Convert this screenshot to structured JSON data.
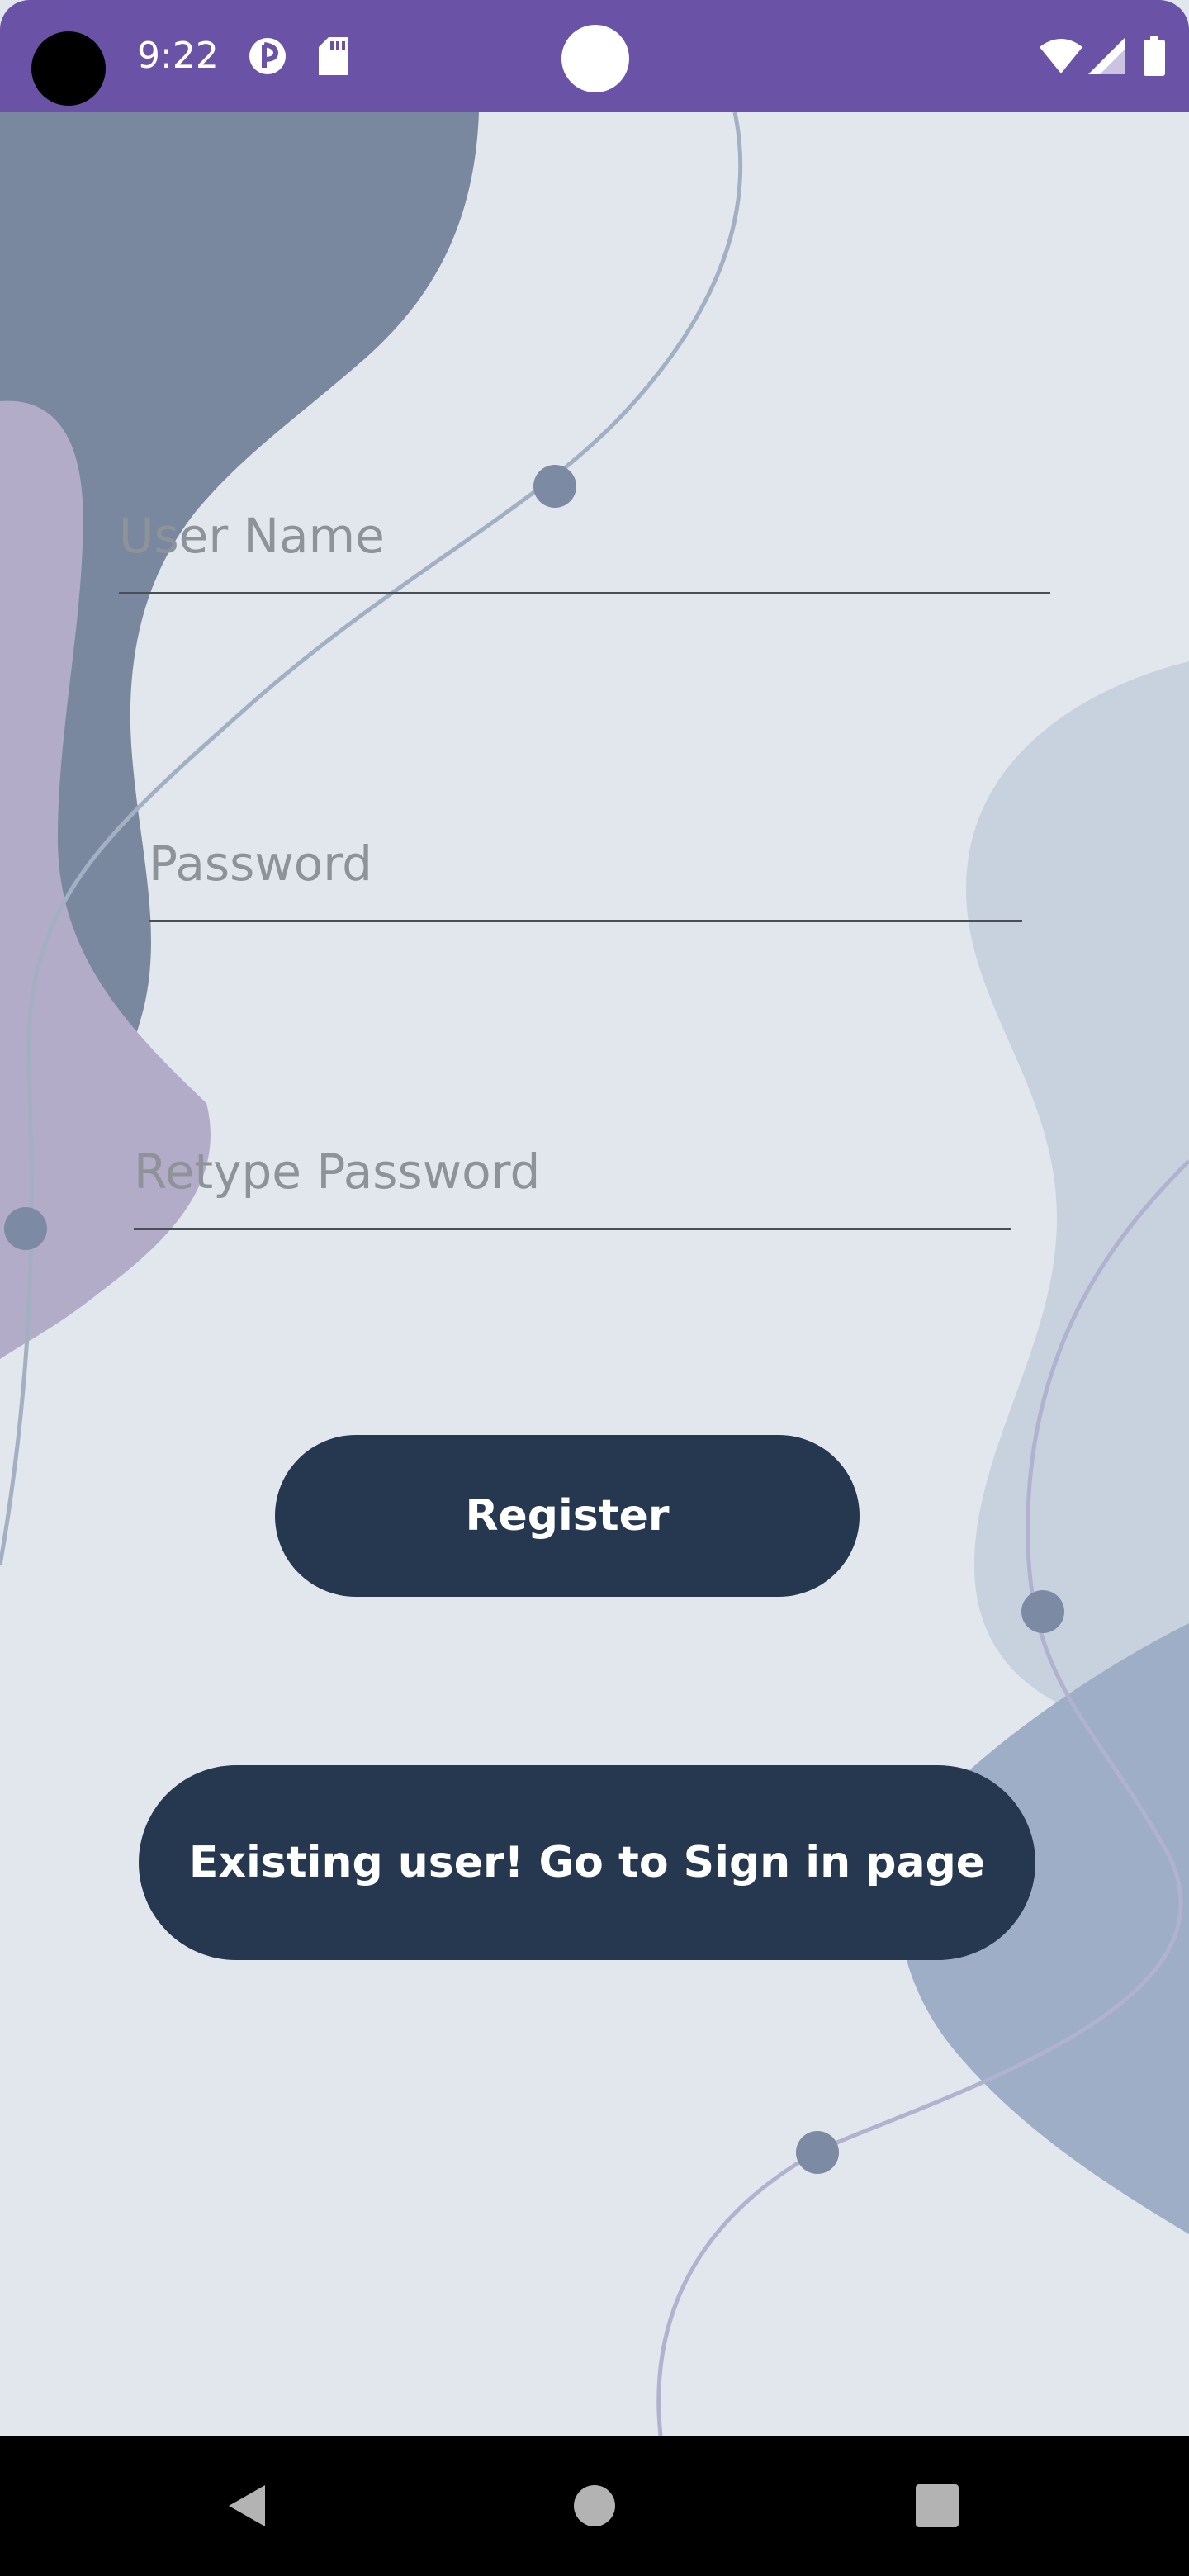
{
  "status_bar": {
    "time": "9:22",
    "icons": [
      "camera-cutout",
      "data-saver-icon",
      "sd-card-icon",
      "notification-dot",
      "wifi-icon",
      "signal-icon",
      "battery-icon"
    ]
  },
  "form": {
    "username": {
      "value": "",
      "placeholder": "User Name"
    },
    "password": {
      "value": "",
      "placeholder": "Password"
    },
    "retype_password": {
      "value": "",
      "placeholder": "Retype Password"
    }
  },
  "buttons": {
    "register": "Register",
    "sign_in": "Existing user! Go to Sign in page"
  },
  "nav_bar": {
    "icons": [
      "back-icon",
      "home-icon",
      "recents-icon"
    ]
  },
  "colors": {
    "status_bar": "#6a53a6",
    "background": "#e1e7ec",
    "button": "#263750",
    "button_text": "#ffffff",
    "placeholder": "#8e939a",
    "underline": "#4a4f57",
    "nav_bar": "#000000"
  }
}
